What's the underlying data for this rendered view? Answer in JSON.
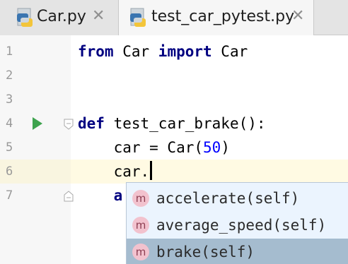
{
  "tabs": [
    {
      "label": "Car.py",
      "active": false,
      "icon": "python-file-icon",
      "close": "✕"
    },
    {
      "label": "test_car_pytest.py",
      "active": true,
      "icon": "python-file-icon",
      "close": "✕"
    }
  ],
  "editor": {
    "line_numbers": [
      "1",
      "2",
      "3",
      "4",
      "5",
      "6",
      "7"
    ],
    "lines": {
      "l1": {
        "kw1": "from",
        "t1": " Car ",
        "kw2": "import",
        "t2": " Car"
      },
      "l4": {
        "kw": "def",
        "t": " test_car_brake():"
      },
      "l5": {
        "t": "    car = Car(",
        "num": "50",
        "t2": ")"
      },
      "l6": {
        "t": "    car."
      },
      "l7": {
        "t": "    a"
      }
    }
  },
  "completion": {
    "items": [
      {
        "badge": "m",
        "text": "accelerate(self)"
      },
      {
        "badge": "m",
        "text": "average_speed(self)"
      },
      {
        "badge": "m",
        "text": "brake(self)"
      }
    ],
    "selected_index": 2
  },
  "colors": {
    "keyword": "#000080",
    "number": "#0000ff",
    "run_icon": "#3ea34e",
    "caret_line": "#fffae3",
    "popup_bg": "#ebf4fe",
    "popup_selected": "#a5bccf"
  }
}
